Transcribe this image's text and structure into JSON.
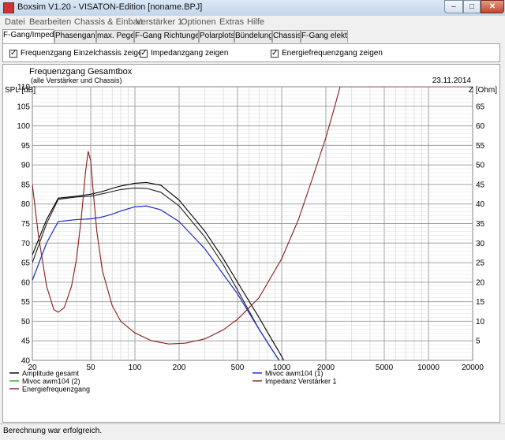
{
  "window": {
    "title": "Boxsim V1.20 - VISATON-Edition [noname.BPJ]"
  },
  "menu": [
    "Datei",
    "Bearbeiten",
    "Chassis & Einbau",
    "Verstärker 1",
    "Optionen",
    "Extras",
    "Hilfe"
  ],
  "tabs": [
    "F-Gang/Imped.",
    "Phasengang",
    "max. Pegel",
    "F-Gang Richtungen",
    "Polarplots",
    "Bündelung",
    "Chassis",
    "F-Gang elektr."
  ],
  "active_tab": 0,
  "checkboxes": [
    {
      "label": "Frequenzgang Einzelchassis zeigen",
      "checked": true
    },
    {
      "label": "Impedanzgang zeigen",
      "checked": true
    },
    {
      "label": "Energiefrequenzgang zeigen",
      "checked": true
    }
  ],
  "status": "Berechnung war erfolgreich.",
  "chart_data": {
    "type": "line",
    "title": "Frequenzgang Gesamtbox",
    "subtitle": "(alle Verstärker und Chassis)",
    "date": "23.11.2014",
    "ylabel": "SPL [dB]",
    "y2label": "Z [Ohm]",
    "x_scale": "log",
    "xlim": [
      20,
      20000
    ],
    "ylim": [
      40,
      110
    ],
    "y2lim": [
      0,
      70
    ],
    "x_ticks": [
      20,
      50,
      100,
      200,
      500,
      1000,
      2000,
      5000,
      10000,
      20000
    ],
    "x_ticklabels": [
      "20",
      "50",
      "100",
      "200",
      "500",
      "1000",
      "2000",
      "5000",
      "10000",
      "20000"
    ],
    "y_ticks": [
      40,
      45,
      50,
      55,
      60,
      65,
      70,
      75,
      80,
      85,
      90,
      95,
      100,
      105,
      110
    ],
    "y2_ticks": [
      5,
      10,
      15,
      20,
      25,
      30,
      35,
      40,
      45,
      50,
      55,
      60,
      65
    ],
    "grid": true,
    "series": [
      {
        "name": "Amplitude gesamt",
        "color": "#000000",
        "axis": "left",
        "x": [
          20,
          25,
          30,
          40,
          50,
          60,
          70,
          80,
          100,
          120,
          150,
          200,
          300,
          400,
          500,
          700,
          850,
          1000,
          1100
        ],
        "y": [
          67,
          76,
          81.5,
          82,
          82.5,
          83.2,
          84,
          84.6,
          85.3,
          85.5,
          84.8,
          81,
          73,
          66,
          60,
          51,
          45.5,
          41,
          38
        ]
      },
      {
        "name": "Energiefrequenzgang",
        "color": "#222222",
        "axis": "left",
        "x": [
          20,
          25,
          30,
          40,
          50,
          60,
          70,
          80,
          100,
          120,
          150,
          200,
          300,
          400,
          500,
          700,
          850,
          1000
        ],
        "y": [
          65,
          75,
          81.2,
          81.8,
          82,
          82.6,
          83.2,
          83.7,
          84.1,
          84,
          83,
          79.5,
          71.5,
          64.5,
          58,
          48,
          43,
          39
        ]
      },
      {
        "name": "Mivoc awm104 (1)",
        "color": "#2222dd",
        "axis": "left",
        "x": [
          20,
          25,
          30,
          40,
          50,
          60,
          70,
          80,
          100,
          120,
          150,
          200,
          300,
          400,
          500,
          700,
          850,
          1000
        ],
        "y": [
          60.5,
          70,
          75.5,
          76,
          76.2,
          76.7,
          77.4,
          78.2,
          79.3,
          79.5,
          78.5,
          75.5,
          68.5,
          62,
          57,
          48,
          43,
          39
        ]
      },
      {
        "name": "Mivoc awm104 (2)",
        "color": "#22aa22",
        "axis": "left",
        "x": [
          20,
          25,
          30,
          40,
          50,
          60,
          70,
          80,
          100,
          120,
          150,
          200,
          300,
          400,
          500,
          700,
          850,
          1000
        ],
        "y": [
          60.5,
          70,
          75.5,
          76,
          76.2,
          76.7,
          77.4,
          78.2,
          79.3,
          79.5,
          78.5,
          75.5,
          68.5,
          62,
          57,
          48,
          43,
          39
        ]
      },
      {
        "name": "Impedanz Verstärker 1",
        "color": "#8b1a1a",
        "axis": "right",
        "x": [
          20,
          22,
          25,
          28,
          30,
          33,
          37,
          40,
          43,
          46,
          48,
          50,
          52,
          55,
          60,
          70,
          80,
          100,
          130,
          170,
          220,
          300,
          400,
          500,
          700,
          1000,
          1300,
          1600,
          2000,
          2300,
          2500,
          3000,
          20000
        ],
        "y": [
          45,
          32,
          19,
          13,
          12.3,
          13.5,
          19,
          26,
          36,
          48,
          53.5,
          51,
          43,
          33,
          23,
          14,
          10,
          7,
          5,
          4.2,
          4.4,
          5.5,
          7.8,
          10.5,
          16,
          26,
          36,
          46,
          57,
          65,
          70,
          70,
          70
        ]
      }
    ],
    "legend": [
      {
        "label": "Amplitude gesamt",
        "color": "#000000"
      },
      {
        "label": "Mivoc awm104 (1)",
        "color": "#2222dd"
      },
      {
        "label": "Mivoc awm104 (2)",
        "color": "#22aa22"
      },
      {
        "label": "Impedanz Verstärker 1",
        "color": "#8b1a1a"
      },
      {
        "label": "Energiefrequenzgang",
        "color": "#8b1a1a"
      }
    ]
  }
}
